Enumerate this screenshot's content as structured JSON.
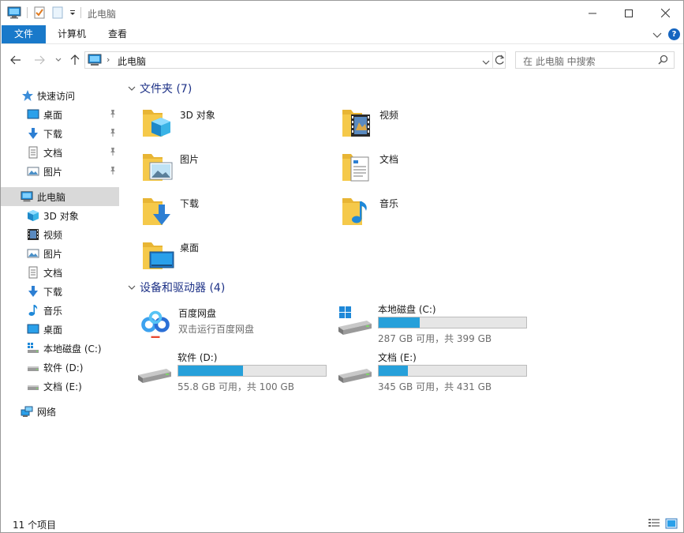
{
  "window": {
    "title": "此电脑"
  },
  "ribbon": {
    "tabs": [
      "文件",
      "计算机",
      "查看"
    ],
    "help": "?"
  },
  "address": {
    "path": "此电脑",
    "search_placeholder": "在 此电脑 中搜索"
  },
  "sidebar": {
    "quick_access": "快速访问",
    "pinned": [
      "桌面",
      "下载",
      "文档",
      "图片"
    ],
    "this_pc": "此电脑",
    "pc_items": [
      "3D 对象",
      "视频",
      "图片",
      "文档",
      "下载",
      "音乐",
      "桌面",
      "本地磁盘 (C:)",
      "软件 (D:)",
      "文档 (E:)"
    ],
    "network": "网络"
  },
  "folders": {
    "header": "文件夹 (7)",
    "items": [
      "3D 对象",
      "视频",
      "图片",
      "文档",
      "下载",
      "音乐",
      "桌面"
    ]
  },
  "devices": {
    "header": "设备和驱动器 (4)",
    "baidu": {
      "name": "百度网盘",
      "subtitle": "双击运行百度网盘"
    },
    "drives": [
      {
        "name": "本地磁盘 (C:)",
        "size": "287 GB 可用，共 399 GB",
        "used_fraction": 0.28
      },
      {
        "name": "软件 (D:)",
        "size": "55.8 GB 可用，共 100 GB",
        "used_fraction": 0.44
      },
      {
        "name": "文档 (E:)",
        "size": "345 GB 可用，共 431 GB",
        "used_fraction": 0.2
      }
    ]
  },
  "status": {
    "count": "11 个项目"
  },
  "colors": {
    "accent": "#1979ca",
    "folder": "#f5c94a",
    "bar": "#26a0da",
    "header": "#1e3287"
  }
}
